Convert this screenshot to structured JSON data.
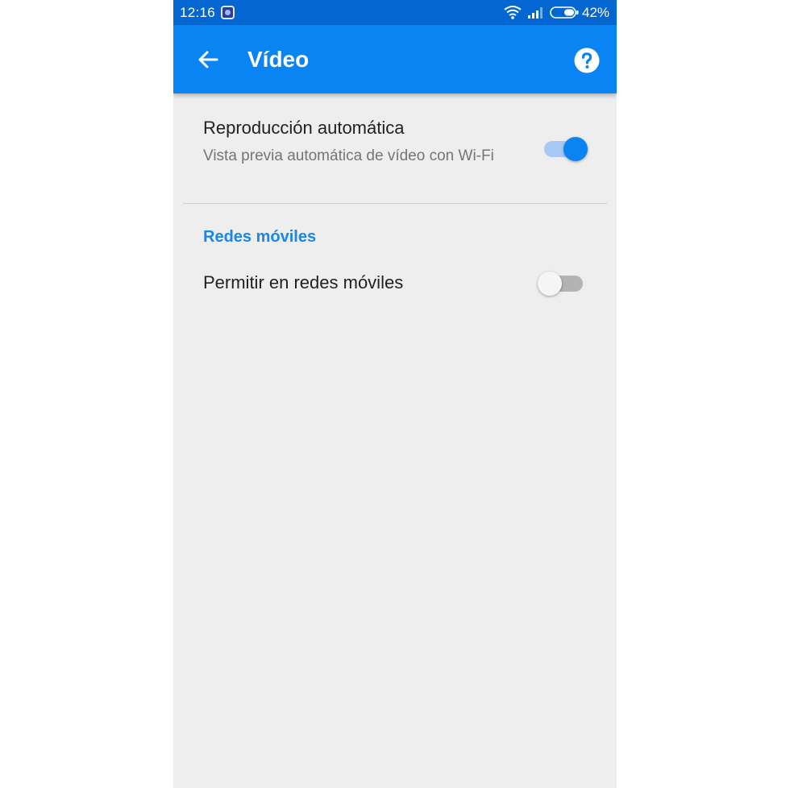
{
  "status_bar": {
    "time": "12:16",
    "battery_percent": "42%",
    "icons": [
      "app-notification-icon",
      "wifi-icon",
      "signal-icon",
      "battery-icon"
    ]
  },
  "app_bar": {
    "title": "Vídeo",
    "back_icon": "arrow-left-icon",
    "help_icon": "help-circle-icon"
  },
  "settings": {
    "autoplay": {
      "title": "Reproducción automática",
      "subtitle": "Vista previa automática de vídeo con Wi-Fi",
      "enabled": true
    },
    "mobile_section": {
      "header": "Redes móviles",
      "allow_mobile": {
        "title": "Permitir en redes móviles",
        "enabled": false
      }
    }
  },
  "colors": {
    "status_bar": "#0467d1",
    "app_bar": "#0a84f3",
    "accent": "#1a87e8",
    "background": "#eeeeee"
  }
}
